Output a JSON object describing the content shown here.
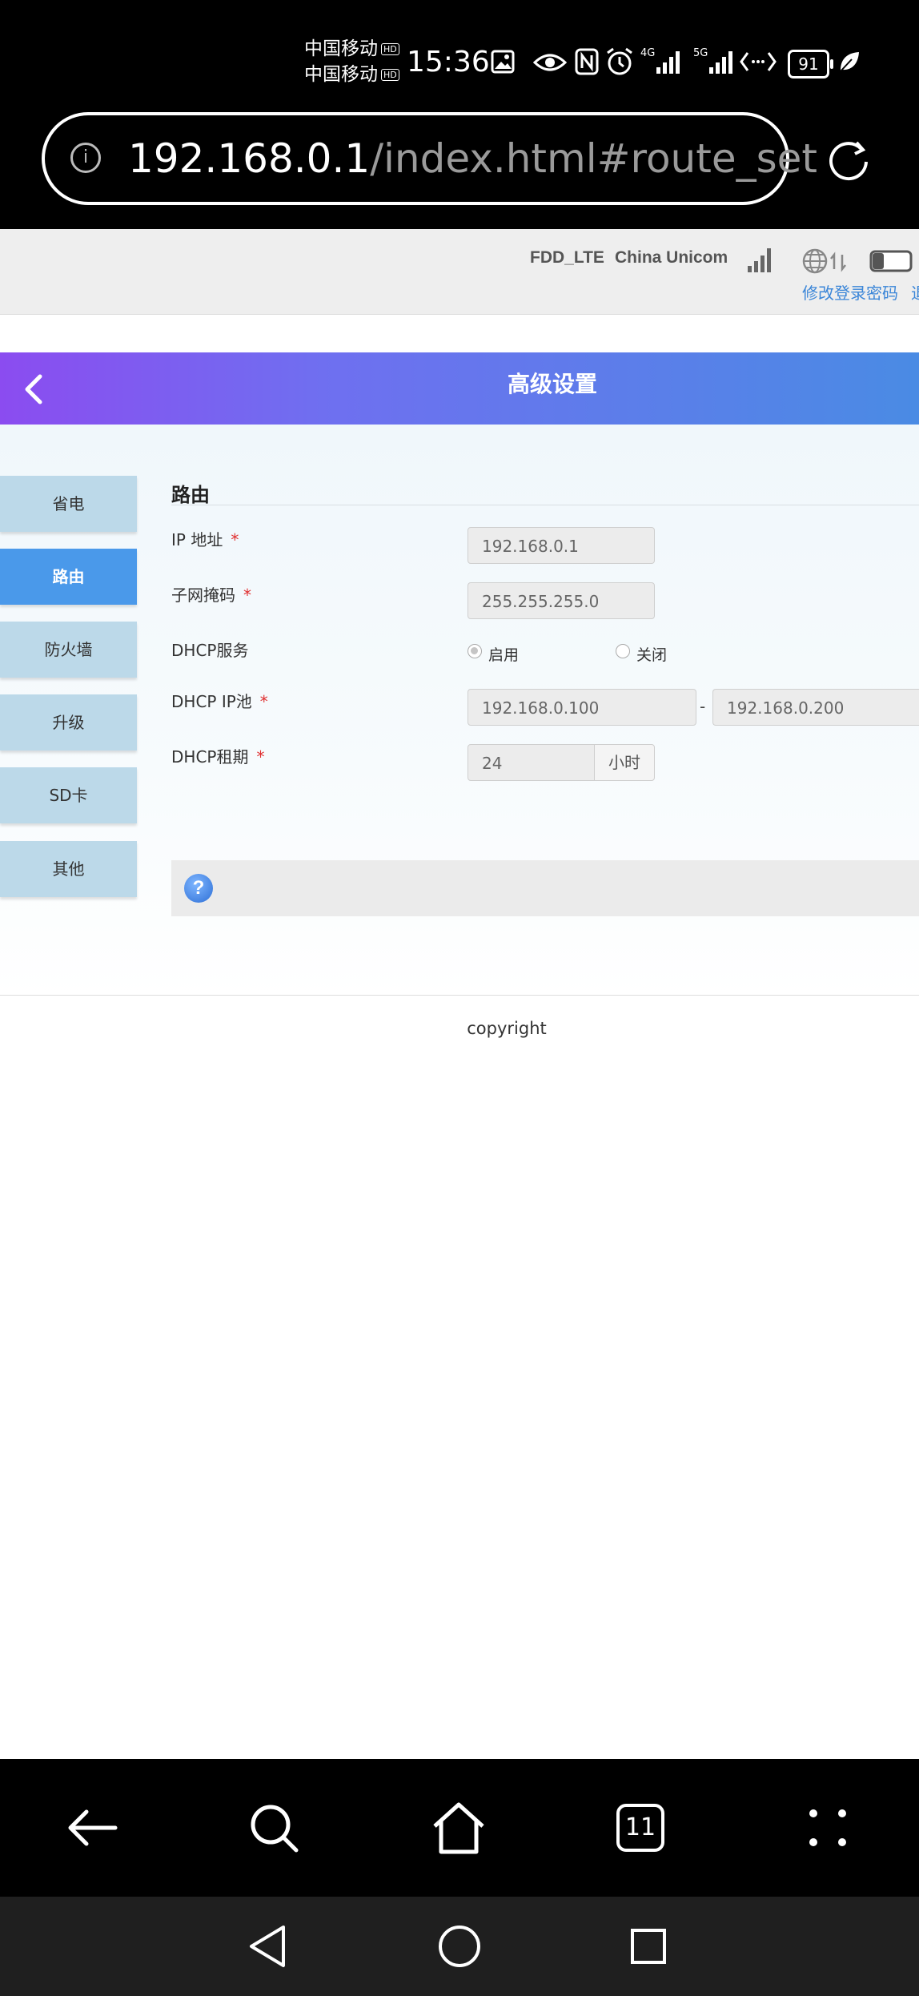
{
  "status_bar": {
    "carrier1": "中国移动",
    "carrier2": "中国移动",
    "hd_badge": "HD",
    "time": "15:36",
    "net_4g": "4G",
    "net_5g": "5G",
    "battery": "91",
    "icons": [
      "image-icon",
      "eye-icon",
      "nfc-icon",
      "alarm-icon",
      "signal-4g-icon",
      "signal-5g-icon",
      "data-transfer-icon",
      "battery-icon",
      "leaf-icon"
    ]
  },
  "browser": {
    "url_host": "192.168.0.1",
    "url_path": "/index.html#route_set"
  },
  "router_bar": {
    "network_type": "FDD_LTE",
    "operator": "China Unicom",
    "change_password": "修改登录密码",
    "cut_link": "退"
  },
  "header": {
    "title": "高级设置"
  },
  "sidebar": {
    "items": [
      {
        "label": "省电"
      },
      {
        "label": "路由"
      },
      {
        "label": "防火墙"
      },
      {
        "label": "升级"
      },
      {
        "label": "SD卡"
      },
      {
        "label": "其他"
      }
    ],
    "active_index": 1
  },
  "form": {
    "section_title": "路由",
    "required_mark": "*",
    "ip_label": "IP 地址",
    "ip_value": "192.168.0.1",
    "mask_label": "子网掩码",
    "mask_value": "255.255.255.0",
    "dhcp_label": "DHCP服务",
    "dhcp_on": "启用",
    "dhcp_off": "关闭",
    "dhcp_selected": "启用",
    "pool_label": "DHCP IP池",
    "pool_start": "192.168.0.100",
    "pool_separator": "-",
    "pool_end": "192.168.0.200",
    "lease_label": "DHCP租期",
    "lease_value": "24",
    "lease_unit": "小时"
  },
  "help": {
    "icon_text": "?"
  },
  "footer": {
    "copyright": "copyright"
  },
  "browser_toolbar": {
    "tabs_count": "11"
  },
  "colors": {
    "accent_blue": "#4a99ea",
    "sidebar_bg": "#bcd9e9",
    "header_gradient_start": "#8b4cf0",
    "header_gradient_end": "#4a8be4",
    "required_red": "#e03030"
  }
}
